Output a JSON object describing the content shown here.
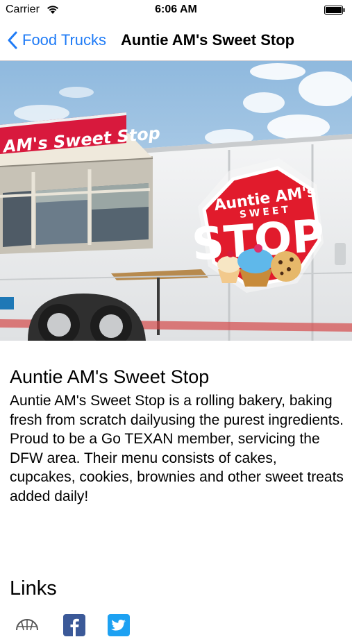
{
  "status_bar": {
    "carrier": "Carrier",
    "time": "6:06 AM",
    "wifi_icon": "wifi-icon",
    "battery_icon": "battery-icon"
  },
  "nav": {
    "back_label": "Food Trucks",
    "title": "Auntie AM's Sweet Stop",
    "accent_color": "#1f7bf6"
  },
  "hero": {
    "banner_text": "AM's Sweet Stop",
    "sign_line1": "Auntie AM's",
    "sign_line2": "SWEET",
    "sign_line3": "STOP"
  },
  "detail": {
    "title": "Auntie AM's Sweet Stop",
    "description": "Auntie AM's Sweet Stop is a rolling bakery, baking fresh from scratch dailyusing the purest ingredients. Proud to be a Go TEXAN member, servicing the DFW area. Their menu consists of cakes, cupcakes, cookies, brownies and other sweet treats added daily!"
  },
  "links": {
    "heading": "Links",
    "items": [
      {
        "icon": "website-icon"
      },
      {
        "icon": "facebook-icon"
      },
      {
        "icon": "twitter-icon"
      }
    ]
  }
}
